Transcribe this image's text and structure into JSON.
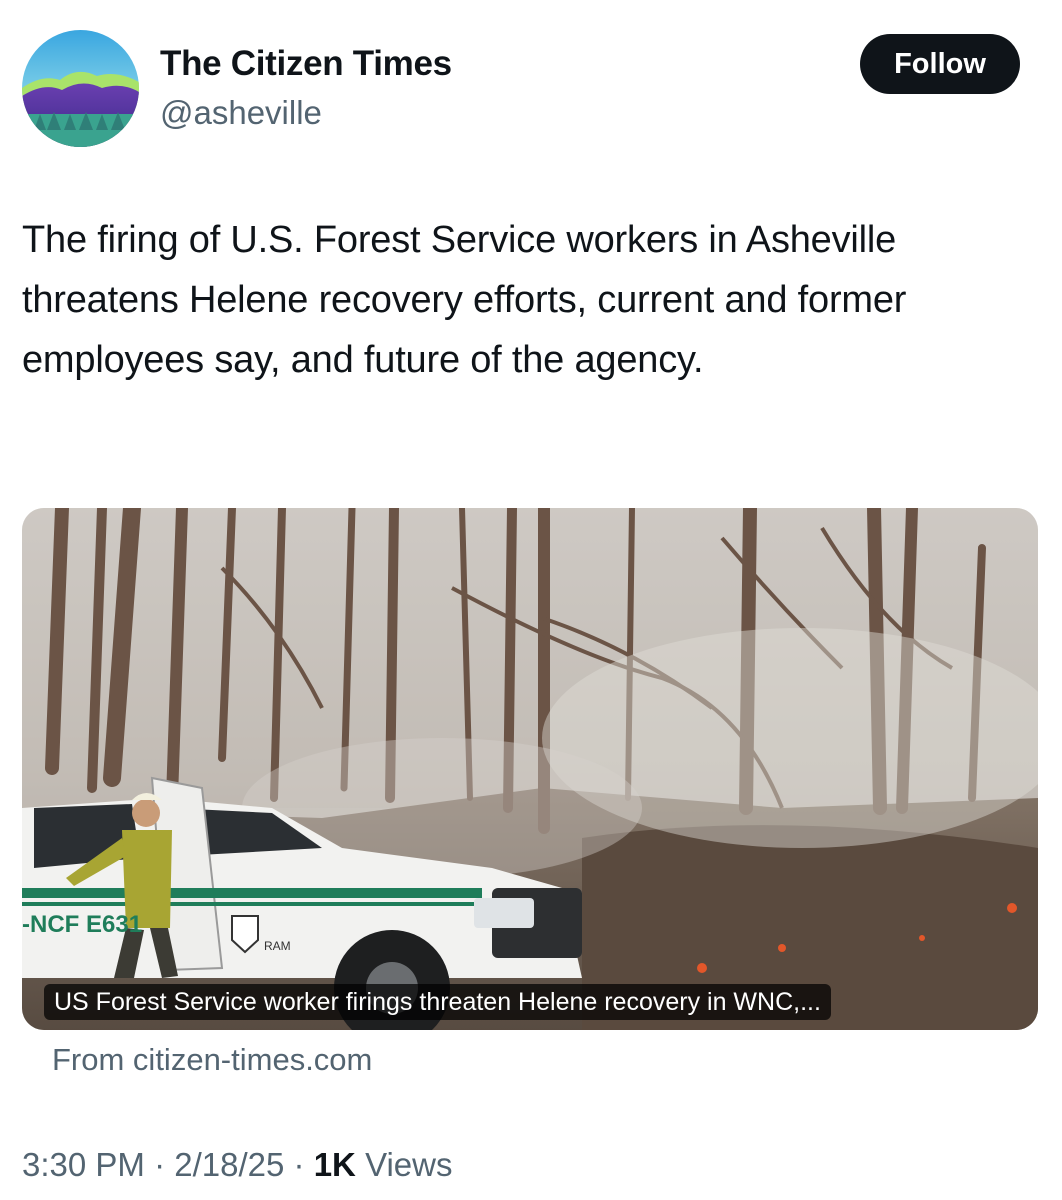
{
  "account": {
    "display_name": "The Citizen Times",
    "handle": "@asheville",
    "avatar_icon": "mountain-landscape-logo-icon",
    "follow_label": "Follow"
  },
  "tweet": {
    "text": "The firing of U.S. Forest Service workers in Asheville threatens Helene recovery efforts, current and former employees say, and future of the agency."
  },
  "link_card": {
    "image_icon": "forest-fire-truck-photo",
    "title": "US Forest Service worker firings threaten Helene recovery in WNC,...",
    "source": "From citizen-times.com",
    "truck_markings": {
      "unit": "-NCF E631",
      "brand": "RAM"
    }
  },
  "meta": {
    "time": "3:30 PM",
    "date": "2/18/25",
    "separator": "·",
    "views_count": "1K",
    "views_label": "Views"
  },
  "colors": {
    "text_primary": "#0f1419",
    "text_secondary": "#536471",
    "button_bg": "#0f1419"
  }
}
